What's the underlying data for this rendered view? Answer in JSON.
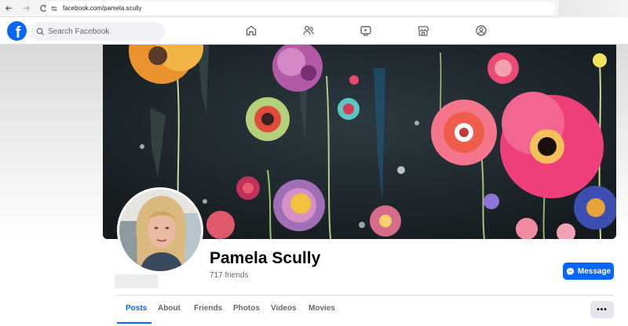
{
  "browser": {
    "url": "facebook.com/pamela.scully"
  },
  "header": {
    "logo_letter": "f",
    "search_placeholder": "Search Facebook",
    "nav_icons": [
      "home-icon",
      "friends-icon",
      "watch-icon",
      "marketplace-icon",
      "groups-icon"
    ]
  },
  "profile": {
    "name": "Pamela Scully",
    "friends": "717 friends",
    "message_label": "Message"
  },
  "tabs": [
    {
      "label": "Posts",
      "active": true
    },
    {
      "label": "About",
      "active": false
    },
    {
      "label": "Friends",
      "active": false
    },
    {
      "label": "Photos",
      "active": false
    },
    {
      "label": "Videos",
      "active": false
    },
    {
      "label": "Movies",
      "active": false
    }
  ],
  "more_label": "•••",
  "colors": {
    "brand": "#0866ff",
    "text_secondary": "#65676b",
    "cover_bg": "#1b2328"
  }
}
